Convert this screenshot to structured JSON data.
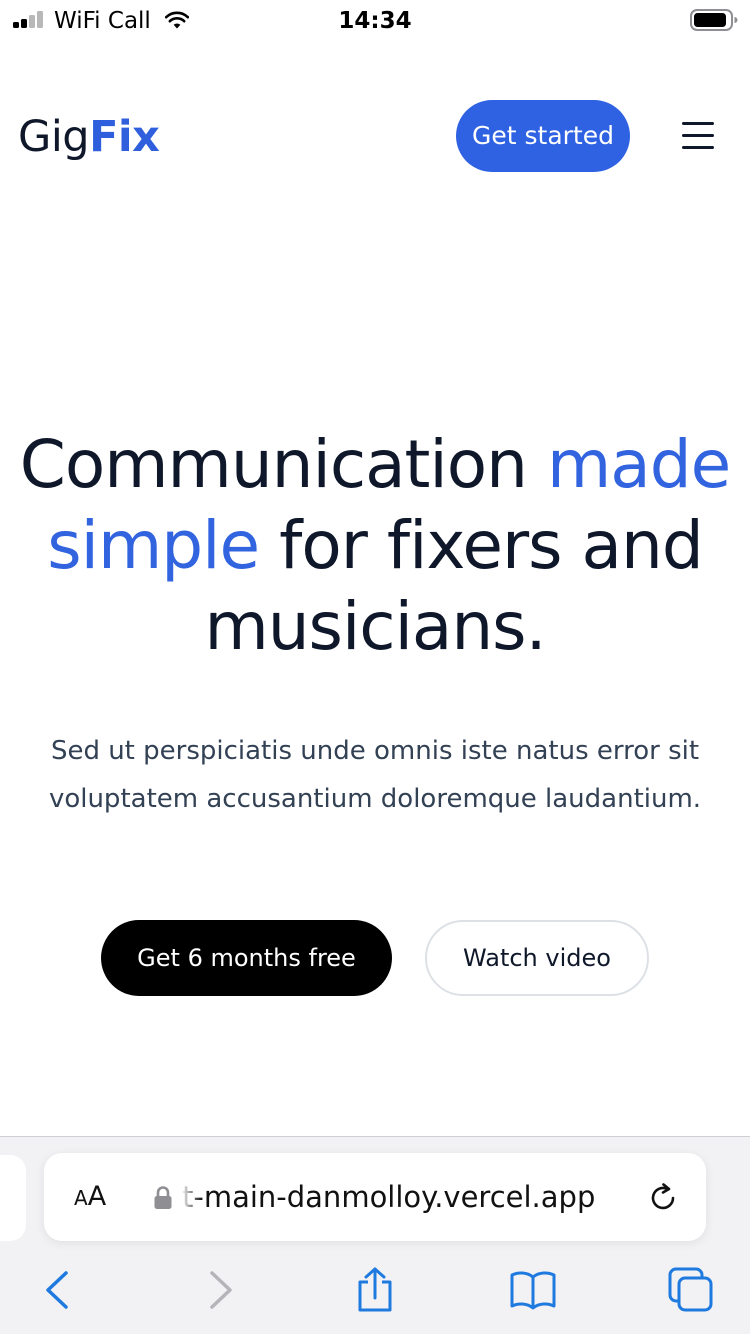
{
  "status_bar": {
    "carrier": "WiFi Call",
    "time": "14:34"
  },
  "header": {
    "logo_part1": "Gig",
    "logo_part2": "Fix",
    "cta_label": "Get started"
  },
  "hero": {
    "title_part1": "Communication ",
    "title_accent": "made simple",
    "title_part2": " for fixers and musicians.",
    "subtitle": "Sed ut perspiciatis unde omnis iste natus error sit voluptatem accusantium doloremque laudantium.",
    "primary_button": "Get 6 months free",
    "secondary_button": "Watch video"
  },
  "browser": {
    "text_size_label_small": "A",
    "text_size_label_large": "A",
    "url": "t-main-danmolloy.vercel.app"
  },
  "colors": {
    "brand_blue": "#2f62e3",
    "ios_blue": "#1f7ae0",
    "dark_button": "#000000"
  },
  "icons": [
    "signal-icon",
    "wifi-icon",
    "battery-icon",
    "menu-icon",
    "lock-icon",
    "reload-icon",
    "back-icon",
    "forward-icon",
    "share-icon",
    "bookmarks-icon",
    "tabs-icon"
  ]
}
